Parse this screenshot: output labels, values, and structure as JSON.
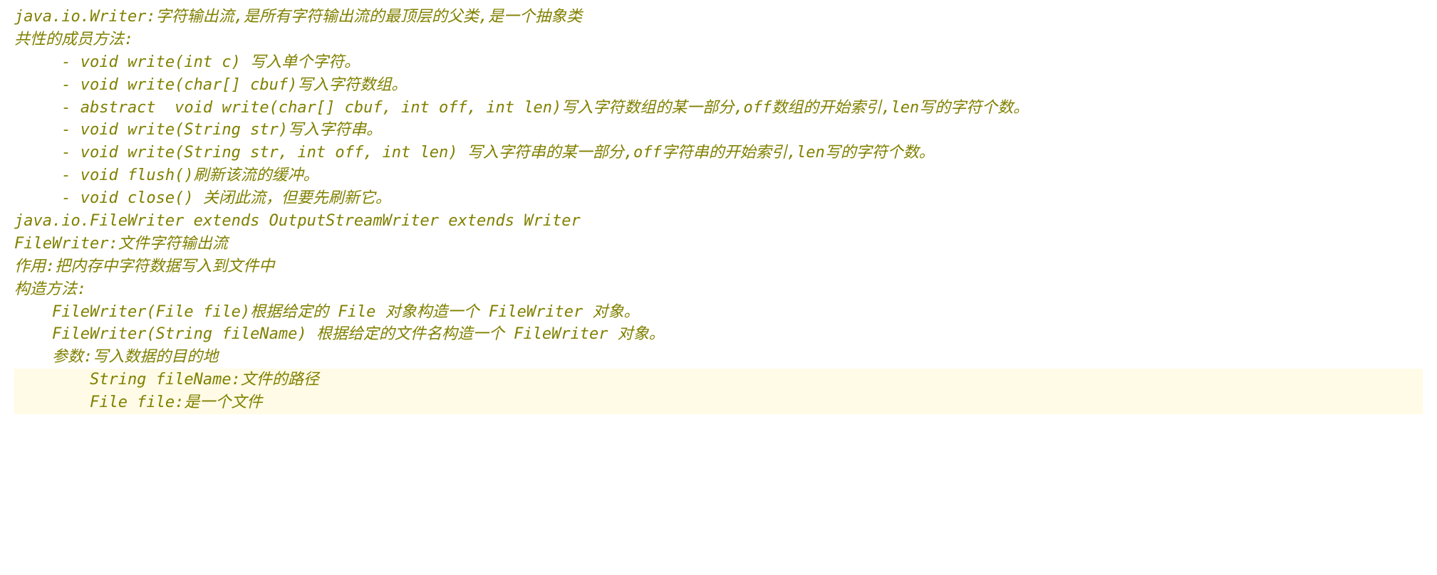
{
  "l1": "java.io.Writer:字符输出流,是所有字符输出流的最顶层的父类,是一个抽象类",
  "l2": "",
  "l3": "共性的成员方法:",
  "l4": "     - void write(int c) 写入单个字符。",
  "l5": "     - void write(char[] cbuf)写入字符数组。",
  "l6": "     - abstract  void write(char[] cbuf, int off, int len)写入字符数组的某一部分,off数组的开始索引,len写的字符个数。",
  "l7": "     - void write(String str)写入字符串。",
  "l8": "     - void write(String str, int off, int len) 写入字符串的某一部分,off字符串的开始索引,len写的字符个数。",
  "l9": "     - void flush()刷新该流的缓冲。",
  "l10": "     - void close() 关闭此流，但要先刷新它。",
  "l11": "",
  "l12": "java.io.FileWriter extends OutputStreamWriter extends Writer",
  "l13": "FileWriter:文件字符输出流",
  "l14": "作用:把内存中字符数据写入到文件中",
  "l15": "",
  "l16": "构造方法:",
  "l17": "    FileWriter(File file)根据给定的 File 对象构造一个 FileWriter 对象。",
  "l18": "    FileWriter(String fileName) 根据给定的文件名构造一个 FileWriter 对象。",
  "l19": "    参数:写入数据的目的地",
  "l20": "        String fileName:文件的路径",
  "l21": "        File file:是一个文件"
}
